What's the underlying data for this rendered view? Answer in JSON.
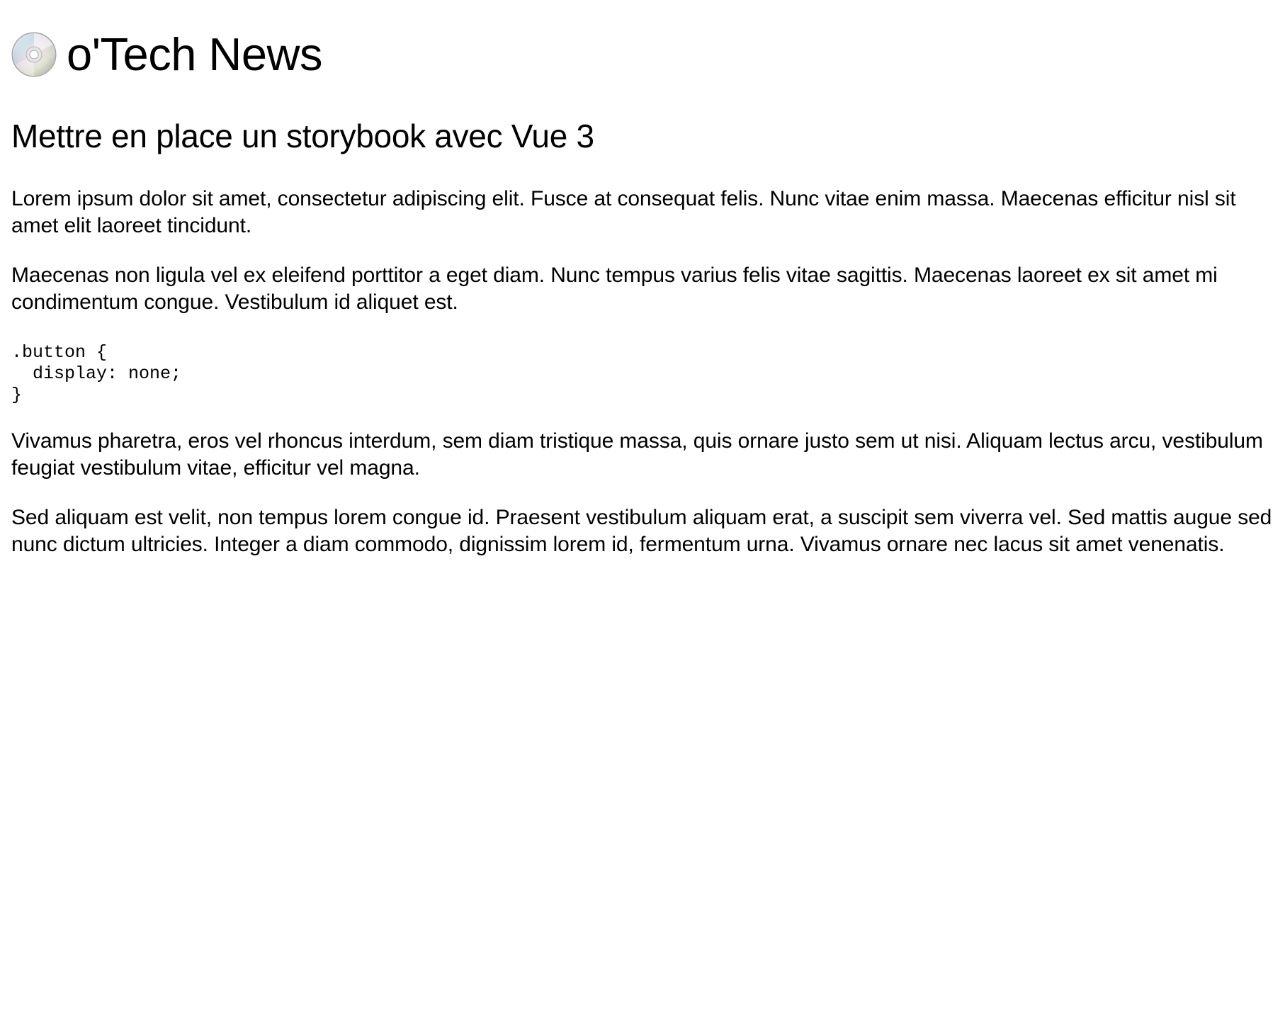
{
  "header": {
    "logo_icon": "cd-disc-icon",
    "site_title": "o'Tech News"
  },
  "article": {
    "title": "Mettre en place un storybook avec Vue 3",
    "paragraphs": [
      "Lorem ipsum dolor sit amet, consectetur adipiscing elit. Fusce at consequat felis. Nunc vitae enim massa. Maecenas efficitur nisl sit amet elit laoreet tincidunt.",
      "Maecenas non ligula vel ex eleifend porttitor a eget diam. Nunc tempus varius felis vitae sagittis. Maecenas laoreet ex sit amet mi condimentum congue. Vestibulum id aliquet est.",
      "Vivamus pharetra, eros vel rhoncus interdum, sem diam tristique massa, quis ornare justo sem ut nisi. Aliquam lectus arcu, vestibulum feugiat vestibulum vitae, efficitur vel magna.",
      "Sed aliquam est velit, non tempus lorem congue id. Praesent vestibulum aliquam erat, a suscipit sem viverra vel. Sed mattis augue sed nunc dictum ultricies. Integer a diam commodo, dignissim lorem id, fermentum urna. Vivamus ornare nec lacus sit amet venenatis."
    ],
    "code": ".button {\n  display: none;\n}"
  }
}
